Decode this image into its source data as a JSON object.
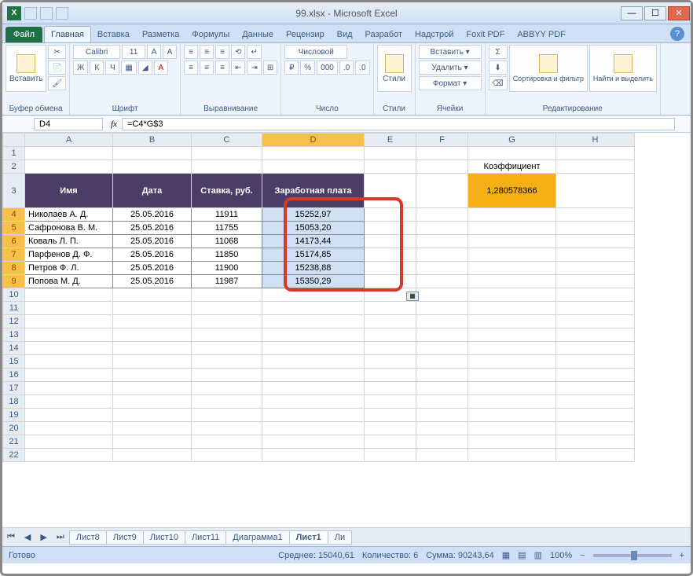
{
  "title": "99.xlsx - Microsoft Excel",
  "qat": {
    "save": "save",
    "undo": "undo",
    "redo": "redo"
  },
  "tabs": {
    "file": "Файл",
    "items": [
      "Главная",
      "Вставка",
      "Разметка",
      "Формулы",
      "Данные",
      "Рецензир",
      "Вид",
      "Разработ",
      "Надстрой",
      "Foxit PDF",
      "ABBYY PDF"
    ],
    "active": 0
  },
  "ribbon": {
    "clipboard": {
      "label": "Буфер обмена",
      "paste": "Вставить"
    },
    "font": {
      "label": "Шрифт",
      "name": "Calibri",
      "size": "11",
      "bold": "Ж",
      "italic": "К",
      "underline": "Ч"
    },
    "align": {
      "label": "Выравнивание"
    },
    "number": {
      "label": "Число",
      "format": "Числовой"
    },
    "styles": {
      "label": "Стили",
      "btn": "Стили"
    },
    "cells": {
      "label": "Ячейки",
      "insert": "Вставить ▾",
      "delete": "Удалить ▾",
      "format": "Формат ▾"
    },
    "editing": {
      "label": "Редактирование",
      "sort": "Сортировка и фильтр",
      "find": "Найти и выделить"
    }
  },
  "namebox": "D4",
  "formula": "=C4*G$3",
  "cols": [
    "A",
    "B",
    "C",
    "D",
    "E",
    "F",
    "G",
    "H"
  ],
  "row2": {
    "G": "Коэффициент"
  },
  "row3": {
    "A": "Имя",
    "B": "Дата",
    "C": "Ставка, руб.",
    "D": "Заработная плата",
    "G": "1,280578366"
  },
  "data": [
    {
      "r": 4,
      "A": "Николаев А. Д.",
      "B": "25.05.2016",
      "C": "11911",
      "D": "15252,97"
    },
    {
      "r": 5,
      "A": "Сафронова В. М.",
      "B": "25.05.2016",
      "C": "11755",
      "D": "15053,20"
    },
    {
      "r": 6,
      "A": "Коваль Л. П.",
      "B": "25.05.2016",
      "C": "11068",
      "D": "14173,44"
    },
    {
      "r": 7,
      "A": "Парфенов Д. Ф.",
      "B": "25.05.2016",
      "C": "11850",
      "D": "15174,85"
    },
    {
      "r": 8,
      "A": "Петров Ф. Л.",
      "B": "25.05.2016",
      "C": "11900",
      "D": "15238,88"
    },
    {
      "r": 9,
      "A": "Попова М. Д.",
      "B": "25.05.2016",
      "C": "11987",
      "D": "15350,29"
    }
  ],
  "sheets": {
    "items": [
      "Лист8",
      "Лист9",
      "Лист10",
      "Лист11",
      "Диаграмма1",
      "Лист1",
      "Ли"
    ],
    "active": 5
  },
  "status": {
    "ready": "Готово",
    "avg_label": "Среднее:",
    "avg": "15040,61",
    "count_label": "Количество:",
    "count": "6",
    "sum_label": "Сумма:",
    "sum": "90243,64",
    "zoom": "100%"
  },
  "chart_data": {
    "type": "table",
    "title": "Заработная плата",
    "headers": [
      "Имя",
      "Дата",
      "Ставка, руб.",
      "Заработная плата"
    ],
    "rows": [
      [
        "Николаев А. Д.",
        "25.05.2016",
        11911,
        15252.97
      ],
      [
        "Сафронова В. М.",
        "25.05.2016",
        11755,
        15053.2
      ],
      [
        "Коваль Л. П.",
        "25.05.2016",
        11068,
        14173.44
      ],
      [
        "Парфенов Д. Ф.",
        "25.05.2016",
        11850,
        15174.85
      ],
      [
        "Петров Ф. Л.",
        "25.05.2016",
        11900,
        15238.88
      ],
      [
        "Попова М. Д.",
        "25.05.2016",
        11987,
        15350.29
      ]
    ],
    "coefficient": 1.280578366
  }
}
